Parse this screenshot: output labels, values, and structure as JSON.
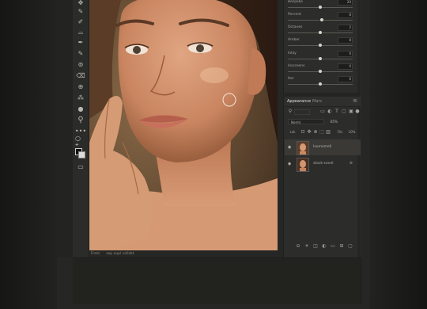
{
  "properties": {
    "rows": [
      {
        "label": "Bespoke",
        "value": "20",
        "level": 0.5
      },
      {
        "label": "Percent",
        "value": "8",
        "level": 0.52
      },
      {
        "label": "Octaves",
        "value": "2",
        "level": 0.5
      },
      {
        "label": "Amber",
        "value": "8",
        "level": 0.5
      },
      {
        "label": "Inlay",
        "value": "0",
        "level": 0.5
      },
      {
        "label": "Inscreens",
        "value": "0",
        "level": 0.5
      },
      {
        "label": "Iter",
        "value": "6",
        "level": 0.5
      }
    ]
  },
  "layers_panel": {
    "tab_active": "Appearance",
    "tab_other": "Mars",
    "blend_mode": "Norml",
    "opacity": "85%",
    "fill": "10%",
    "flip_label": "Flis",
    "lock_label": "Lok",
    "layers": [
      {
        "name": "Isumamell",
        "selected": true
      },
      {
        "name": "stock-covel",
        "selected": false
      }
    ]
  },
  "status": {
    "left": "Frem",
    "right": "sep oupl cellsbt"
  },
  "icons": {
    "toolbar": [
      "move-icon",
      "brush-icon",
      "lasso-icon",
      "crop-icon",
      "eyedropper-icon",
      "healing-icon",
      "stamp-icon",
      "eraser-icon",
      "gradient-icon",
      "dodge-icon",
      "pen-icon",
      "type-icon",
      "search-icon",
      "more-icon",
      "hand-icon",
      "zoom-icon",
      "color-swatch-icon",
      "screen-mode-icon"
    ]
  }
}
